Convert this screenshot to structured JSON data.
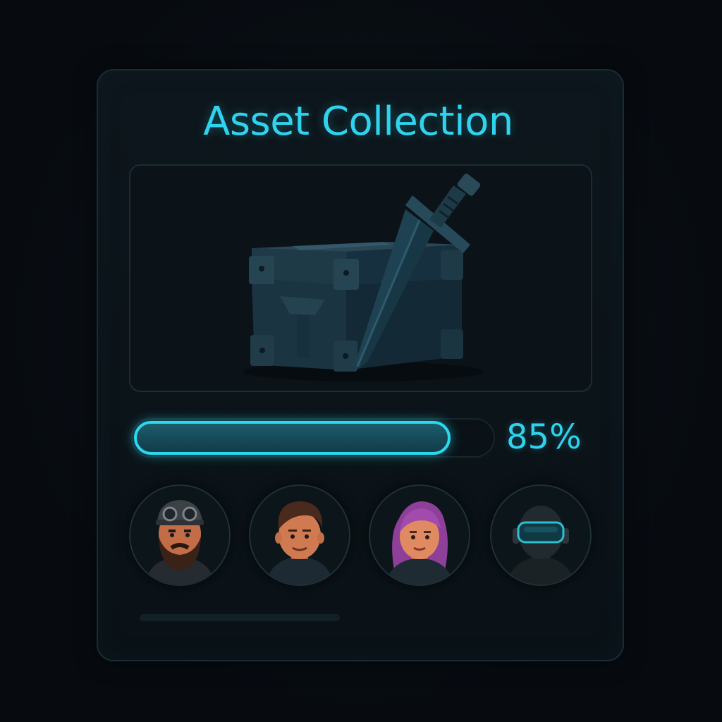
{
  "title": "Asset Collection",
  "showcase": {
    "icons": [
      "treasure-chest-icon",
      "sword-icon"
    ]
  },
  "progress": {
    "value": 0.85,
    "label": "85%"
  },
  "avatars": [
    {
      "name": "avatar-bearded-goggles"
    },
    {
      "name": "avatar-man-brown-hair"
    },
    {
      "name": "avatar-woman-purple-hair"
    },
    {
      "name": "avatar-visor-helmet"
    }
  ],
  "colors": {
    "accent": "#2fd3ee",
    "panel": "#0d161c",
    "background": "#070b10"
  }
}
